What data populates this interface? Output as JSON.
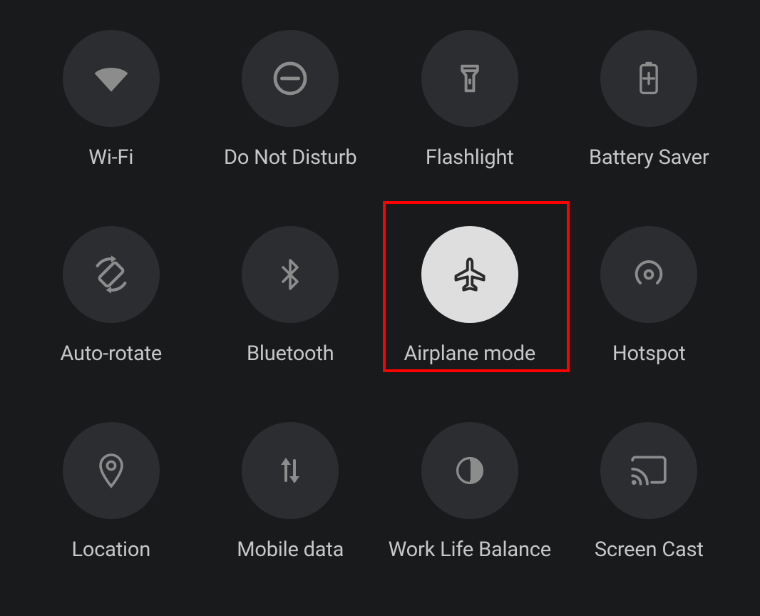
{
  "tiles": {
    "wifi": {
      "label": "Wi-Fi"
    },
    "dnd": {
      "label": "Do Not Disturb"
    },
    "flashlight": {
      "label": "Flashlight"
    },
    "battery_saver": {
      "label": "Battery Saver"
    },
    "auto_rotate": {
      "label": "Auto-rotate"
    },
    "bluetooth": {
      "label": "Bluetooth"
    },
    "airplane_mode": {
      "label": "Airplane mode"
    },
    "hotspot": {
      "label": "Hotspot"
    },
    "location": {
      "label": "Location"
    },
    "mobile_data": {
      "label": "Mobile data"
    },
    "work_life_balance": {
      "label": "Work Life Balance"
    },
    "screen_cast": {
      "label": "Screen Cast"
    }
  },
  "highlight": {
    "target": "airplane_mode"
  },
  "colors": {
    "bg": "#181a1c",
    "tile_off": "#2b2d30",
    "tile_on": "#dedede",
    "icon_off": "#8c8c8c",
    "icon_on": "#2b2b2b",
    "label": "#c7c7c7",
    "highlight": "#ff0000"
  }
}
